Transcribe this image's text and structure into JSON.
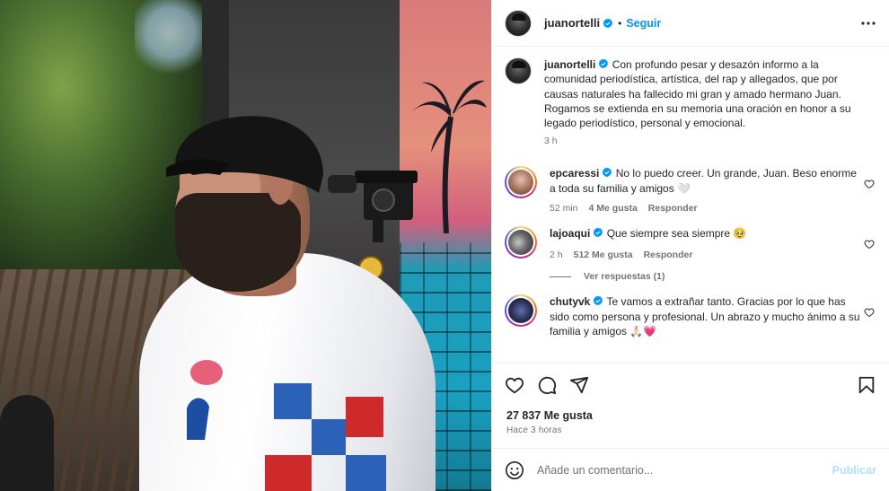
{
  "post": {
    "username": "juanortelli",
    "follow_label": "Seguir",
    "separator": "•",
    "caption_user": "juanortelli",
    "caption": "Con profundo pesar y desazón informo a la comunidad periodística, artística, del rap y allegados, que por causas naturales ha fallecido mi gran y amado hermano Juan. Rogamos se extienda en su memoria una oración en honor a su legado periodístico, personal y emocional.",
    "caption_time": "3 h",
    "likes": "27 837 Me gusta",
    "posted_ago": "Hace 3 horas"
  },
  "comments": [
    {
      "user": "epcaressi",
      "text": "No lo puedo creer. Un grande, Juan. Beso enorme a toda su familia y amigos 🤍",
      "time": "52 min",
      "likes": "4 Me gusta",
      "reply": "Responder"
    },
    {
      "user": "lajoaqui",
      "text": "Que siempre sea siempre 🥹",
      "time": "2 h",
      "likes": "512 Me gusta",
      "reply": "Responder",
      "view_replies": "Ver respuestas (1)"
    },
    {
      "user": "chutyvk",
      "text": "Te vamos a extrañar tanto. Gracias por lo que has sido como persona y profesional. Un abrazo y mucho ánimo a su familia y amigos 🙏🏻💗"
    }
  ],
  "composer": {
    "placeholder": "Añade un comentario...",
    "publish_label": "Publicar"
  },
  "icons": {
    "like": "heart-icon",
    "comment": "comment-icon",
    "share": "share-icon",
    "save": "bookmark-icon",
    "emoji": "smile-icon",
    "more": "more-icon",
    "verified": "verified-badge-icon"
  },
  "colors": {
    "link_blue": "#0095f6",
    "publish_disabled": "#b2dffc",
    "muted_text": "#737373",
    "text": "#262626",
    "verified": "#0095f6"
  }
}
